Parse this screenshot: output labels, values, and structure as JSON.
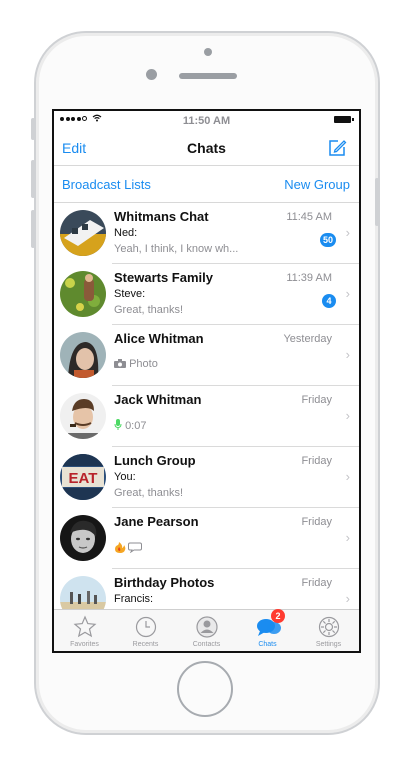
{
  "status": {
    "time": "11:50 AM"
  },
  "nav": {
    "edit": "Edit",
    "title": "Chats"
  },
  "links": {
    "broadcast": "Broadcast Lists",
    "new_group": "New Group"
  },
  "chats": [
    {
      "name": "Whitmans Chat",
      "time": "11:45 AM",
      "sender": "Ned:",
      "preview": "Yeah, I think, I know wh...",
      "badge": "50"
    },
    {
      "name": "Stewarts Family",
      "time": "11:39 AM",
      "sender": "Steve:",
      "preview": "Great, thanks!",
      "badge": "4"
    },
    {
      "name": "Alice Whitman",
      "time": "Yesterday",
      "preview": "Photo",
      "preview_icon": "camera-icon"
    },
    {
      "name": "Jack Whitman",
      "time": "Friday",
      "preview": "0:07",
      "preview_icon": "microphone-icon"
    },
    {
      "name": "Lunch Group",
      "time": "Friday",
      "sender": "You:",
      "preview": "Great, thanks!",
      "avatar_text": "EAT"
    },
    {
      "name": "Jane Pearson",
      "time": "Friday",
      "preview": "",
      "preview_icon": "fire-speech-bubble-icon"
    },
    {
      "name": "Birthday Photos",
      "time": "Friday",
      "sender": "Francis:",
      "preview": ""
    }
  ],
  "tabs": [
    {
      "label": "Favorites",
      "icon": "star-icon"
    },
    {
      "label": "Recents",
      "icon": "clock-icon"
    },
    {
      "label": "Contacts",
      "icon": "contact-icon"
    },
    {
      "label": "Chats",
      "icon": "chat-bubbles-icon",
      "active": true,
      "badge": "2"
    },
    {
      "label": "Settings",
      "icon": "gear-icon"
    }
  ],
  "colors": {
    "accent": "#1a8cf0",
    "badge_red": "#ff3b30"
  }
}
